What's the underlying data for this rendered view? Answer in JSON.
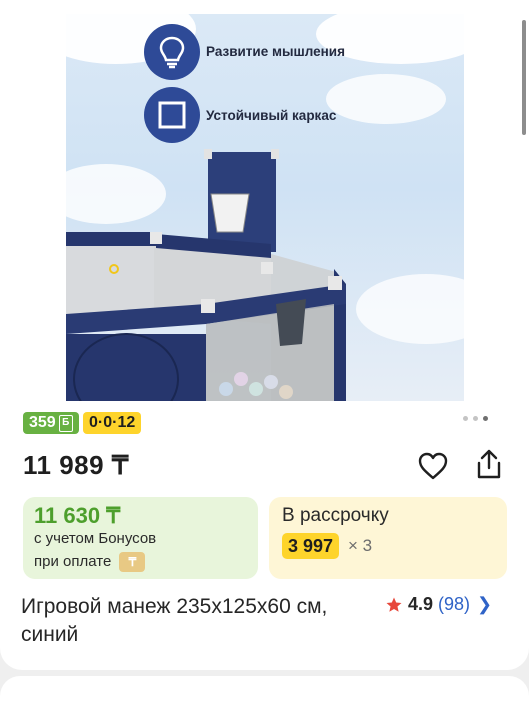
{
  "gallery": {
    "features": [
      {
        "label": "Развитие мышления",
        "icon": "lightbulb-icon"
      },
      {
        "label": "Устойчивый каркас",
        "icon": "square-frame-icon"
      }
    ],
    "dots_count": 3,
    "active_dot": 2
  },
  "badges": {
    "bonus": "359",
    "installment": "0·0·12"
  },
  "price": {
    "value": "11 989 ₸"
  },
  "bonus_box": {
    "price": "11 630 ₸",
    "line1": "с учетом Бонусов",
    "line2": "при оплате"
  },
  "installment_box": {
    "title": "В рассрочку",
    "amount": "3 997",
    "multiplier": "× 3"
  },
  "product": {
    "title": "Игровой манеж 235х125х60 см, синий",
    "rating": "4.9",
    "reviews": "(98)"
  },
  "colors": {
    "bonus_green": "#68b142",
    "installment_yellow": "#fed42b",
    "link_blue": "#2f63c7",
    "star_red": "#e7473b",
    "navy": "#2e4a97"
  }
}
